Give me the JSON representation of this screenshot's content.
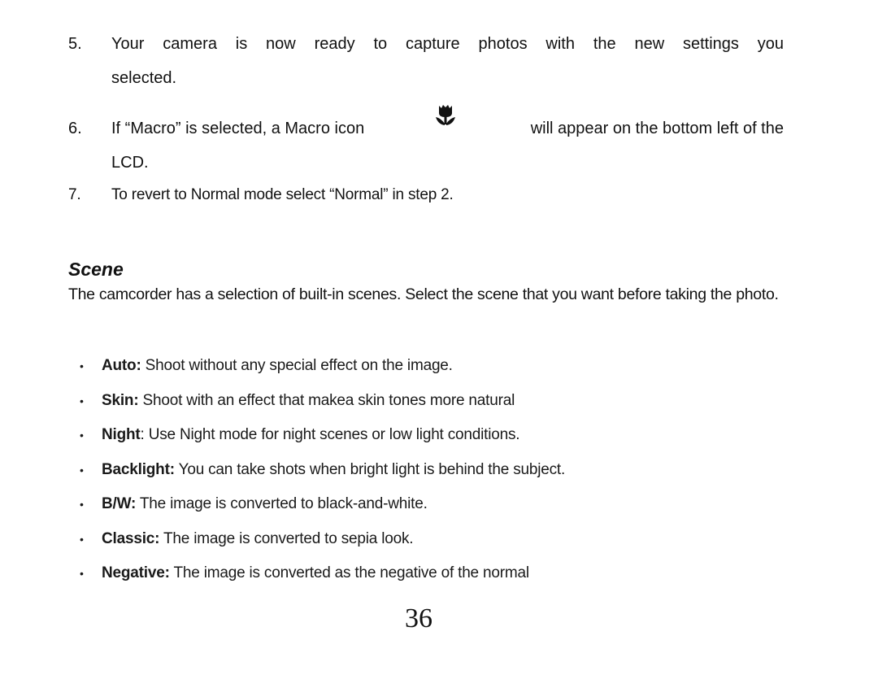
{
  "steps": [
    {
      "number": "5.",
      "line1": "Your camera is now ready to capture photos with the new settings you",
      "line2": "selected."
    },
    {
      "number": "6.",
      "before_icon": "If “Macro” is selected, a Macro icon",
      "icon": "macro-flower-icon",
      "after_icon": "will appear on the bottom left of the",
      "line2": "LCD."
    },
    {
      "number": "7.",
      "text": "To revert to Normal mode select “Normal” in step 2."
    }
  ],
  "section": {
    "heading": "Scene",
    "description": "The camcorder has a selection of built-in scenes. Select the scene that you want before taking the photo."
  },
  "scenes": [
    {
      "bullet": "•",
      "term": "Auto:",
      "text": " Shoot without any special effect on the image."
    },
    {
      "bullet": "•",
      "term": "Skin:",
      "text": " Shoot with an effect that makea skin tones more natural"
    },
    {
      "bullet": "•",
      "term": "Night",
      "text": ": Use Night mode for night scenes or low light conditions."
    },
    {
      "bullet": "•",
      "term": "Backlight:",
      "text": " You can take shots when bright light is behind the subject."
    },
    {
      "bullet": "•",
      "term": "B/W:",
      "text": " The image is converted to black-and-white."
    },
    {
      "bullet": "•",
      "term": "Classic:",
      "text": " The image is converted to sepia look."
    },
    {
      "bullet": "•",
      "term": "Negative:",
      "text": " The image is converted as the negative of the normal"
    }
  ],
  "page_number": "36"
}
